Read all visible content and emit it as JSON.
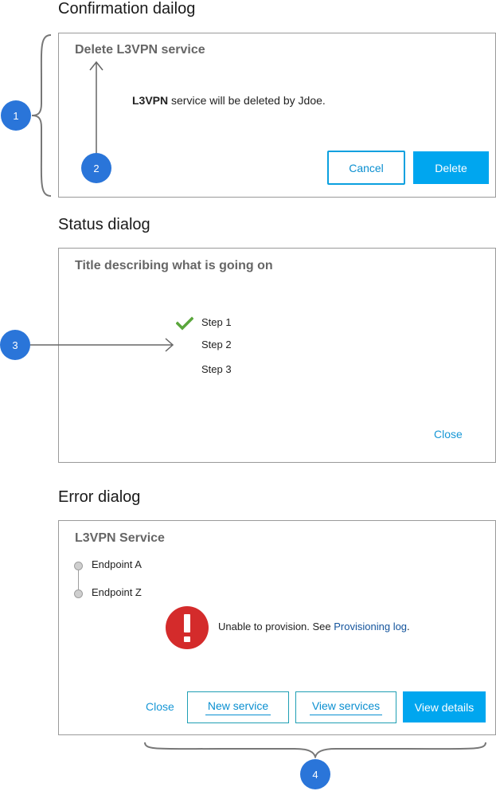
{
  "confirmation": {
    "heading": "Confirmation dailog",
    "title": "Delete L3VPN service",
    "message_bold": "L3VPN",
    "message_rest": " service will be deleted by Jdoe.",
    "cancel_label": "Cancel",
    "delete_label": "Delete"
  },
  "status": {
    "heading": "Status dialog",
    "title": "Title describing what is going on",
    "steps": [
      {
        "label": "Step 1",
        "state": "complete"
      },
      {
        "label": "Step 2",
        "state": "current"
      },
      {
        "label": "Step 3",
        "state": "pending"
      }
    ],
    "close_label": "Close"
  },
  "error": {
    "heading": "Error dialog",
    "title": "L3VPN Service",
    "endpoints": [
      "Endpoint A",
      "Endpoint Z"
    ],
    "message": "Unable to provision. See ",
    "log_link": "Provisioning log",
    "message_end": ".",
    "close_label": "Close",
    "new_service_label": "New service",
    "view_services_label": "View services",
    "view_details_label": "View details"
  },
  "annotations": {
    "badge_1": "1",
    "badge_2": "2",
    "badge_3": "3",
    "badge_4": "4"
  },
  "colors": {
    "accent": "#00a6ef",
    "badge": "#2a75d9",
    "success": "#5aa63c",
    "error": "#d42b2b"
  },
  "icons": [
    "check-icon",
    "error-icon",
    "brace-icon",
    "arrow-icon"
  ]
}
